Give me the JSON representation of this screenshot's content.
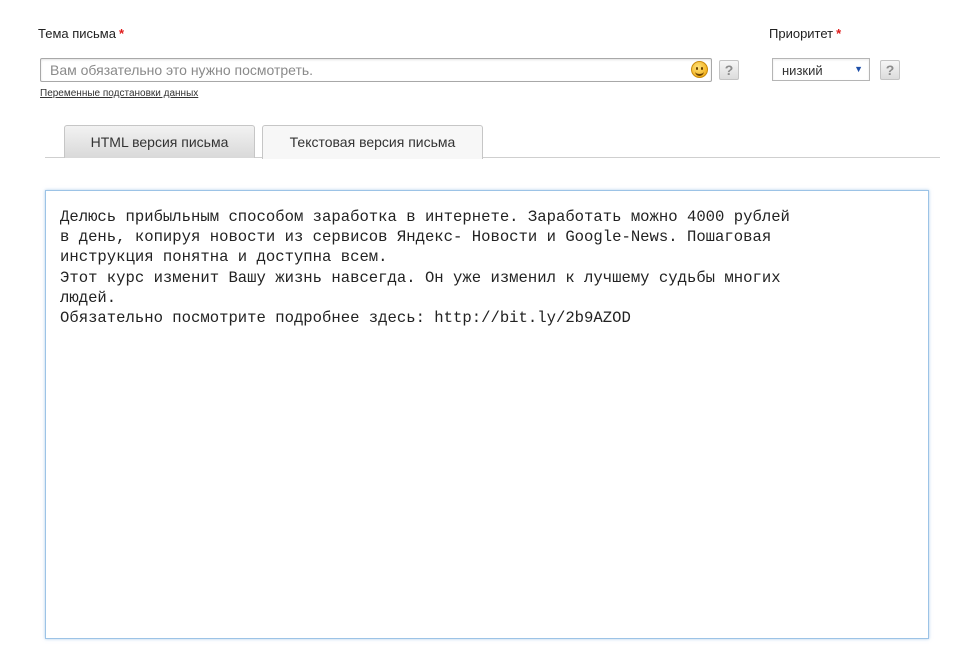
{
  "subject": {
    "label": "Тема письма",
    "required_mark": "*",
    "value": "Вам обязательно это нужно посмотреть.",
    "emoji_icon": "smiley-face-icon",
    "help": "?",
    "vars_link": "Переменные подстановки данных"
  },
  "priority": {
    "label": "Приоритет",
    "required_mark": "*",
    "selected": "низкий",
    "arrow": "▼",
    "help": "?"
  },
  "tabs": [
    {
      "label": "HTML версия письма",
      "active": false
    },
    {
      "label": "Текстовая версия письма",
      "active": true
    }
  ],
  "body_text": "Делюсь прибыльным способом заработка в интернете. Заработать можно 4000 рублей\nв день, копируя новости из сервисов Яндекс- Новости и Google-News. Пошаговая\nинструкция понятна и доступна всем.\nЭтот курс изменит Вашу жизнь навсегда. Он уже изменил к лучшему судьбы многих\nлюдей.\nОбязательно посмотрите подробнее здесь: http://bit.ly/2b9AZOD",
  "colors": {
    "required": "#e01b1b",
    "editor_border": "#9cc3e6",
    "select_arrow": "#1e4fa8"
  }
}
